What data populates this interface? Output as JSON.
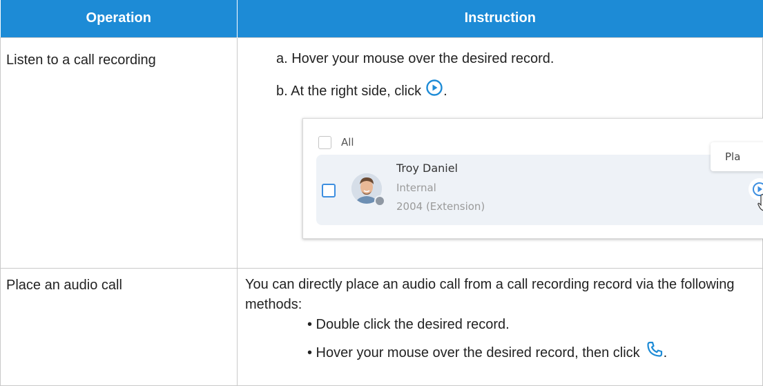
{
  "table": {
    "headers": {
      "operation": "Operation",
      "instruction": "Instruction"
    },
    "rows": [
      {
        "operation": "Listen to a call recording",
        "steps": {
          "a": "a. Hover your mouse over the desired record.",
          "b": "b. At the right side, click",
          "b_end": "."
        },
        "screenshot": {
          "select_all_label": "All",
          "contact_name": "Troy Daniel",
          "call_type": "Internal",
          "extension": "2004 (Extension)",
          "tooltip": "Pla"
        }
      },
      {
        "operation": "Place an audio call",
        "intro": "You can directly place an audio call from a call recording record via the following methods:",
        "bullets": {
          "one": "• Double click the desired record.",
          "two": "• Hover your mouse over the desired record, then click",
          "two_end": "."
        }
      }
    ]
  },
  "colors": {
    "header_bg": "#1d8bd6",
    "accent_blue": "#3c8ee0",
    "card_bg": "#eef2f7"
  },
  "icons": [
    "play-circle-icon",
    "phone-icon",
    "checkbox-icon",
    "avatar-icon",
    "hand-cursor-icon"
  ]
}
